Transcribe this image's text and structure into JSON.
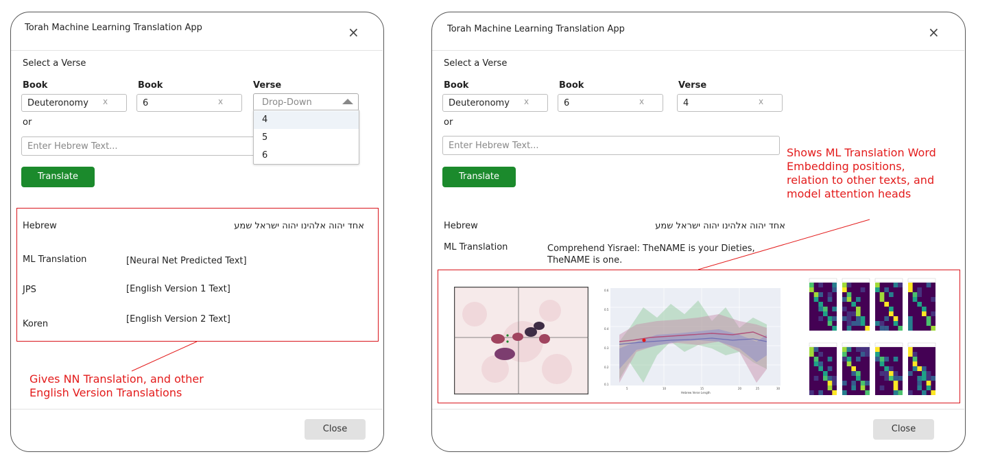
{
  "left": {
    "title": "Torah Machine Learning Translation App",
    "select_label": "Select a Verse",
    "col1_label": "Book",
    "col2_label": "Book",
    "col3_label": "Verse",
    "book_value": "Deuteronomy",
    "chapter_value": "6",
    "verse_placeholder": "Drop-Down",
    "dropdown_options": [
      "4",
      "5",
      "6"
    ],
    "or_label": "or",
    "hebrew_placeholder": "Enter Hebrew Text...",
    "translate_label": "Translate",
    "rows": {
      "hebrew_label": "Hebrew",
      "hebrew_value": "אחד יהוה אלהינו יהוה ישראל שמע",
      "ml_label": "ML Translation",
      "ml_value": "[Neural Net Predicted Text]",
      "jps_label": "JPS",
      "jps_value": "[English Version 1 Text]",
      "koren_label": "Koren",
      "koren_value": "[English Version 2 Text]"
    },
    "annotation_line1": "Gives NN Translation, and other",
    "annotation_line2": "English Version Translations",
    "close_label": "Close",
    "clear_glyph": "x",
    "close_glyph": "×"
  },
  "right": {
    "title": "Torah Machine Learning Translation App",
    "select_label": "Select a Verse",
    "col1_label": "Book",
    "col2_label": "Book",
    "col3_label": "Verse",
    "book_value": "Deuteronomy",
    "chapter_value": "6",
    "verse_value": "4",
    "or_label": "or",
    "hebrew_placeholder": "Enter Hebrew Text...",
    "translate_label": "Translate",
    "hebrew_label": "Hebrew",
    "hebrew_value": "אחד יהוה אלהינו יהוה ישראל שמע",
    "ml_label": "ML Translation",
    "ml_value_line1": "Comprehend Yisrael: TheNAME is your Dieties,",
    "ml_value_line2": "TheNAME is one.",
    "annotation_line1": "Shows ML Translation Word",
    "annotation_line2": "Embedding positions,",
    "annotation_line3": "relation to other texts, and",
    "annotation_line4": "model attention heads",
    "plot_xlabel": "Hebrew Verse Length",
    "plot_xticks": [
      "5",
      "10",
      "15",
      "20",
      "25",
      "30"
    ],
    "plot_yticks": [
      "0.6",
      "0.5",
      "0.4",
      "0.3",
      "0.2",
      "0.1"
    ],
    "close_label": "Close",
    "clear_glyph": "x",
    "close_glyph": "×"
  },
  "colors": {
    "accent_green": "#1b8a2c",
    "annotation_red": "#e31b1b",
    "border": "#555555"
  }
}
